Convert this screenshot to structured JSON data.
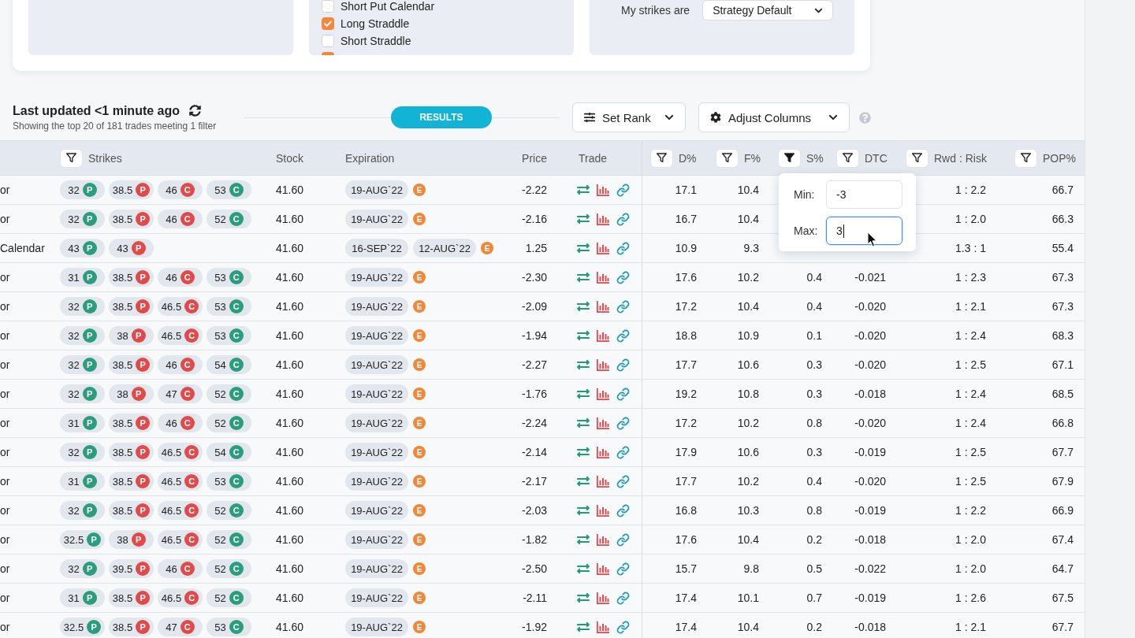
{
  "filter_panels": [
    {
      "kind": "blank"
    },
    {
      "kind": "checklist",
      "items": [
        {
          "label": "Short Put Calendar",
          "checked": false
        },
        {
          "label": "Long Straddle",
          "checked": true
        },
        {
          "label": "Short Straddle",
          "checked": false
        },
        {
          "checked": true
        }
      ]
    },
    {
      "kind": "select",
      "label": "My strikes are",
      "value": "Strategy Default"
    }
  ],
  "results_bar": {
    "title": "Last updated <1 minute ago",
    "subtitle": "Showing the top 20 of 181 trades meeting 1 filter",
    "section_label": "RESULTS",
    "buttons": [
      {
        "kind": "rank",
        "label": "Set Rank"
      },
      {
        "kind": "columns",
        "label": "Adjust Columns"
      }
    ]
  },
  "table": {
    "columns": [
      {
        "label": "Strikes",
        "filterable": true,
        "filter_active": false
      },
      {
        "label": "Stock",
        "filterable": false,
        "filter_active": false
      },
      {
        "label": "Expiration",
        "filterable": false,
        "filter_active": false
      },
      {
        "label": "Price",
        "filterable": false,
        "filter_active": false
      },
      {
        "label": "Trade",
        "filterable": false,
        "filter_active": false
      },
      {
        "label": "D%",
        "filterable": true,
        "filter_active": false
      },
      {
        "label": "F%",
        "filterable": true,
        "filter_active": false
      },
      {
        "label": "S%",
        "filterable": true,
        "filter_active": true
      },
      {
        "label": "DTC",
        "filterable": true,
        "filter_active": false
      },
      {
        "label": "Rwd : Risk",
        "filterable": true,
        "filter_active": false
      },
      {
        "label": "POP%",
        "filterable": true,
        "filter_active": false
      }
    ],
    "rows": [
      {
        "column_1": "or",
        "strikes": [
          {
            "value": "32",
            "type": "P",
            "color": "#2a9d7c"
          },
          {
            "value": "38.5",
            "type": "P",
            "color": "#e04a4a"
          },
          {
            "value": "46",
            "type": "C",
            "color": "#e04a4a"
          },
          {
            "value": "53",
            "type": "C",
            "color": "#2a9d7c"
          }
        ],
        "stock": "41.60",
        "expirations": [
          "19-AUG`22"
        ],
        "earnings": "E",
        "price": "-2.22",
        "d_pct": "17.1",
        "f_pct": "10.4",
        "rwd_risk": "1 : 2.2",
        "pop_pct": "66.7"
      },
      {
        "column_1": "or",
        "strikes": [
          {
            "value": "32",
            "type": "P",
            "color": "#2a9d7c"
          },
          {
            "value": "38.5",
            "type": "P",
            "color": "#e04a4a"
          },
          {
            "value": "46",
            "type": "C",
            "color": "#e04a4a"
          },
          {
            "value": "52",
            "type": "C",
            "color": "#2a9d7c"
          }
        ],
        "stock": "41.60",
        "expirations": [
          "19-AUG`22"
        ],
        "earnings": "E",
        "price": "-2.16",
        "d_pct": "16.7",
        "f_pct": "10.4",
        "rwd_risk": "1 : 2.0",
        "pop_pct": "66.3"
      },
      {
        "column_1": "Calendar",
        "strikes": [
          {
            "value": "43",
            "type": "P",
            "color": "#2a9d7c"
          },
          {
            "value": "43",
            "type": "P",
            "color": "#e04a4a"
          }
        ],
        "stock": "41.60",
        "expirations": [
          "16-SEP`22",
          "12-AUG`22"
        ],
        "earnings": "E",
        "price": "1.25",
        "d_pct": "10.9",
        "f_pct": "9.3",
        "rwd_risk": "1.3 : 1",
        "pop_pct": "55.4"
      },
      {
        "column_1": "or",
        "strikes": [
          {
            "value": "31",
            "type": "P",
            "color": "#2a9d7c"
          },
          {
            "value": "38.5",
            "type": "P",
            "color": "#e04a4a"
          },
          {
            "value": "46",
            "type": "C",
            "color": "#e04a4a"
          },
          {
            "value": "53",
            "type": "C",
            "color": "#2a9d7c"
          }
        ],
        "stock": "41.60",
        "expirations": [
          "19-AUG`22"
        ],
        "earnings": "E",
        "price": "-2.30",
        "d_pct": "17.6",
        "f_pct": "10.2",
        "s_pct": "0.4",
        "dtc": "-0.021",
        "rwd_risk": "1 : 2.3",
        "pop_pct": "67.3"
      },
      {
        "column_1": "or",
        "strikes": [
          {
            "value": "32",
            "type": "P",
            "color": "#2a9d7c"
          },
          {
            "value": "38.5",
            "type": "P",
            "color": "#e04a4a"
          },
          {
            "value": "46.5",
            "type": "C",
            "color": "#e04a4a"
          },
          {
            "value": "53",
            "type": "C",
            "color": "#2a9d7c"
          }
        ],
        "stock": "41.60",
        "expirations": [
          "19-AUG`22"
        ],
        "earnings": "E",
        "price": "-2.09",
        "d_pct": "17.2",
        "f_pct": "10.4",
        "s_pct": "0.4",
        "dtc": "-0.020",
        "rwd_risk": "1 : 2.1",
        "pop_pct": "67.3"
      },
      {
        "column_1": "or",
        "strikes": [
          {
            "value": "32",
            "type": "P",
            "color": "#2a9d7c"
          },
          {
            "value": "38",
            "type": "P",
            "color": "#e04a4a"
          },
          {
            "value": "46.5",
            "type": "C",
            "color": "#e04a4a"
          },
          {
            "value": "53",
            "type": "C",
            "color": "#2a9d7c"
          }
        ],
        "stock": "41.60",
        "expirations": [
          "19-AUG`22"
        ],
        "earnings": "E",
        "price": "-1.94",
        "d_pct": "18.8",
        "f_pct": "10.9",
        "s_pct": "0.1",
        "dtc": "-0.020",
        "rwd_risk": "1 : 2.4",
        "pop_pct": "68.3"
      },
      {
        "column_1": "or",
        "strikes": [
          {
            "value": "32",
            "type": "P",
            "color": "#2a9d7c"
          },
          {
            "value": "38.5",
            "type": "P",
            "color": "#e04a4a"
          },
          {
            "value": "46",
            "type": "C",
            "color": "#e04a4a"
          },
          {
            "value": "54",
            "type": "C",
            "color": "#2a9d7c"
          }
        ],
        "stock": "41.60",
        "expirations": [
          "19-AUG`22"
        ],
        "earnings": "E",
        "price": "-2.27",
        "d_pct": "17.7",
        "f_pct": "10.6",
        "s_pct": "0.3",
        "dtc": "-0.020",
        "rwd_risk": "1 : 2.5",
        "pop_pct": "67.1"
      },
      {
        "column_1": "or",
        "strikes": [
          {
            "value": "32",
            "type": "P",
            "color": "#2a9d7c"
          },
          {
            "value": "38",
            "type": "P",
            "color": "#e04a4a"
          },
          {
            "value": "47",
            "type": "C",
            "color": "#e04a4a"
          },
          {
            "value": "52",
            "type": "C",
            "color": "#2a9d7c"
          }
        ],
        "stock": "41.60",
        "expirations": [
          "19-AUG`22"
        ],
        "earnings": "E",
        "price": "-1.76",
        "d_pct": "19.2",
        "f_pct": "10.8",
        "s_pct": "0.3",
        "dtc": "-0.018",
        "rwd_risk": "1 : 2.4",
        "pop_pct": "68.5"
      },
      {
        "column_1": "or",
        "strikes": [
          {
            "value": "31",
            "type": "P",
            "color": "#2a9d7c"
          },
          {
            "value": "38.5",
            "type": "P",
            "color": "#e04a4a"
          },
          {
            "value": "46",
            "type": "C",
            "color": "#e04a4a"
          },
          {
            "value": "52",
            "type": "C",
            "color": "#2a9d7c"
          }
        ],
        "stock": "41.60",
        "expirations": [
          "19-AUG`22"
        ],
        "earnings": "E",
        "price": "-2.24",
        "d_pct": "17.2",
        "f_pct": "10.2",
        "s_pct": "0.8",
        "dtc": "-0.020",
        "rwd_risk": "1 : 2.4",
        "pop_pct": "66.8"
      },
      {
        "column_1": "or",
        "strikes": [
          {
            "value": "32",
            "type": "P",
            "color": "#2a9d7c"
          },
          {
            "value": "38.5",
            "type": "P",
            "color": "#e04a4a"
          },
          {
            "value": "46.5",
            "type": "C",
            "color": "#e04a4a"
          },
          {
            "value": "54",
            "type": "C",
            "color": "#2a9d7c"
          }
        ],
        "stock": "41.60",
        "expirations": [
          "19-AUG`22"
        ],
        "earnings": "E",
        "price": "-2.14",
        "d_pct": "17.9",
        "f_pct": "10.6",
        "s_pct": "0.3",
        "dtc": "-0.019",
        "rwd_risk": "1 : 2.5",
        "pop_pct": "67.7"
      },
      {
        "column_1": "or",
        "strikes": [
          {
            "value": "31",
            "type": "P",
            "color": "#2a9d7c"
          },
          {
            "value": "38.5",
            "type": "P",
            "color": "#e04a4a"
          },
          {
            "value": "46.5",
            "type": "C",
            "color": "#e04a4a"
          },
          {
            "value": "53",
            "type": "C",
            "color": "#2a9d7c"
          }
        ],
        "stock": "41.60",
        "expirations": [
          "19-AUG`22"
        ],
        "earnings": "E",
        "price": "-2.17",
        "d_pct": "17.7",
        "f_pct": "10.2",
        "s_pct": "0.4",
        "dtc": "-0.020",
        "rwd_risk": "1 : 2.5",
        "pop_pct": "67.9"
      },
      {
        "column_1": "or",
        "strikes": [
          {
            "value": "32",
            "type": "P",
            "color": "#2a9d7c"
          },
          {
            "value": "38.5",
            "type": "P",
            "color": "#e04a4a"
          },
          {
            "value": "46.5",
            "type": "C",
            "color": "#e04a4a"
          },
          {
            "value": "52",
            "type": "C",
            "color": "#2a9d7c"
          }
        ],
        "stock": "41.60",
        "expirations": [
          "19-AUG`22"
        ],
        "earnings": "E",
        "price": "-2.03",
        "d_pct": "16.8",
        "f_pct": "10.3",
        "s_pct": "0.8",
        "dtc": "-0.019",
        "rwd_risk": "1 : 2.2",
        "pop_pct": "66.9"
      },
      {
        "column_1": "or",
        "strikes": [
          {
            "value": "32.5",
            "type": "P",
            "color": "#2a9d7c"
          },
          {
            "value": "38",
            "type": "P",
            "color": "#e04a4a"
          },
          {
            "value": "46.5",
            "type": "C",
            "color": "#e04a4a"
          },
          {
            "value": "52",
            "type": "C",
            "color": "#2a9d7c"
          }
        ],
        "stock": "41.60",
        "expirations": [
          "19-AUG`22"
        ],
        "earnings": "E",
        "price": "-1.82",
        "d_pct": "17.6",
        "f_pct": "10.4",
        "s_pct": "0.2",
        "dtc": "-0.018",
        "rwd_risk": "1 : 2.0",
        "pop_pct": "67.4"
      },
      {
        "column_1": "or",
        "strikes": [
          {
            "value": "32",
            "type": "P",
            "color": "#2a9d7c"
          },
          {
            "value": "39.5",
            "type": "P",
            "color": "#e04a4a"
          },
          {
            "value": "46",
            "type": "C",
            "color": "#e04a4a"
          },
          {
            "value": "52",
            "type": "C",
            "color": "#2a9d7c"
          }
        ],
        "stock": "41.60",
        "expirations": [
          "19-AUG`22"
        ],
        "earnings": "E",
        "price": "-2.50",
        "d_pct": "15.7",
        "f_pct": "9.8",
        "s_pct": "0.5",
        "dtc": "-0.022",
        "rwd_risk": "1 : 2.0",
        "pop_pct": "64.7"
      },
      {
        "column_1": "or",
        "strikes": [
          {
            "value": "31",
            "type": "P",
            "color": "#2a9d7c"
          },
          {
            "value": "38.5",
            "type": "P",
            "color": "#e04a4a"
          },
          {
            "value": "46.5",
            "type": "C",
            "color": "#e04a4a"
          },
          {
            "value": "52",
            "type": "C",
            "color": "#2a9d7c"
          }
        ],
        "stock": "41.60",
        "expirations": [
          "19-AUG`22"
        ],
        "earnings": "E",
        "price": "-2.11",
        "d_pct": "17.4",
        "f_pct": "10.1",
        "s_pct": "0.7",
        "dtc": "-0.019",
        "rwd_risk": "1 : 2.6",
        "pop_pct": "67.5"
      },
      {
        "column_1": "or",
        "strikes": [
          {
            "value": "32.5",
            "type": "P",
            "color": "#2a9d7c"
          },
          {
            "value": "38.5",
            "type": "P",
            "color": "#e04a4a"
          },
          {
            "value": "47",
            "type": "C",
            "color": "#e04a4a"
          },
          {
            "value": "53",
            "type": "C",
            "color": "#2a9d7c"
          }
        ],
        "stock": "41.60",
        "expirations": [
          "19-AUG`22"
        ],
        "earnings": "E",
        "price": "-1.92",
        "d_pct": "17.4",
        "f_pct": "10.4",
        "s_pct": "0.2",
        "dtc": "-0.018",
        "rwd_risk": "1 : 2.1",
        "pop_pct": "67.7"
      }
    ]
  },
  "filter_popover": {
    "fields": [
      {
        "label": "Min:",
        "value": "-3",
        "focused": false
      },
      {
        "label": "Max:",
        "value": "3",
        "focused": true
      }
    ]
  }
}
